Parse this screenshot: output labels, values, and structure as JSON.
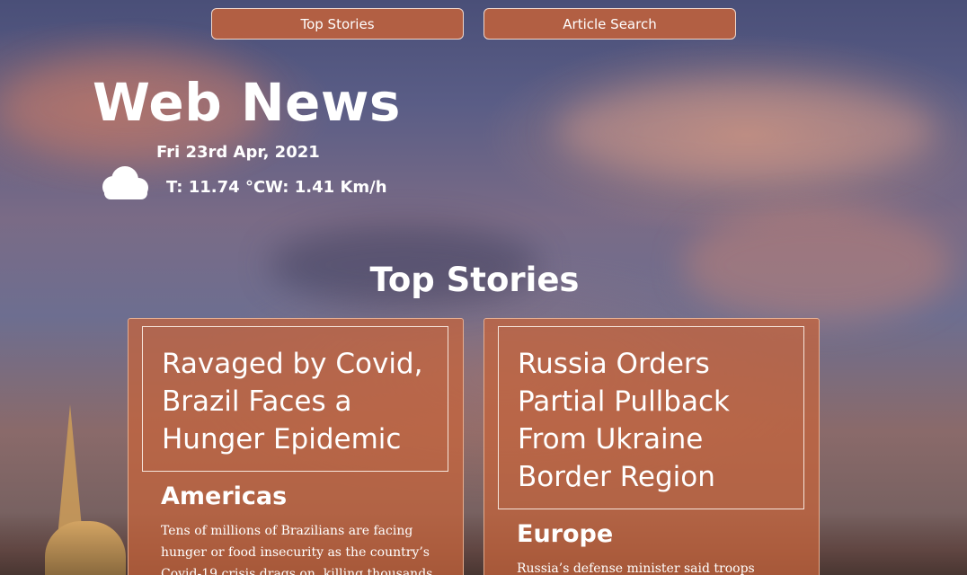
{
  "nav": {
    "top_stories_label": "Top Stories",
    "article_search_label": "Article Search"
  },
  "brand": {
    "title": "Web News"
  },
  "weather": {
    "date": "Fri 23rd Apr, 2021",
    "temperature": "T: 11.74 °C",
    "wind": "W: 1.41 Km/h",
    "icon": "cloud-icon"
  },
  "main": {
    "section_title": "Top Stories",
    "articles": [
      {
        "headline": "Ravaged by Covid, Brazil Faces a Hunger Epidemic",
        "section": "Americas",
        "abstract": "Tens of millions of Brazilians are facing hunger or food insecurity as the country’s Covid-19 crisis drags on, killing thousands"
      },
      {
        "headline": "Russia Orders Partial Pullback From Ukraine Border Region",
        "section": "Europe",
        "abstract": "Russia’s defense minister said troops"
      }
    ]
  },
  "colors": {
    "accent": "#c4623a",
    "card_border": "#f6e4da"
  }
}
